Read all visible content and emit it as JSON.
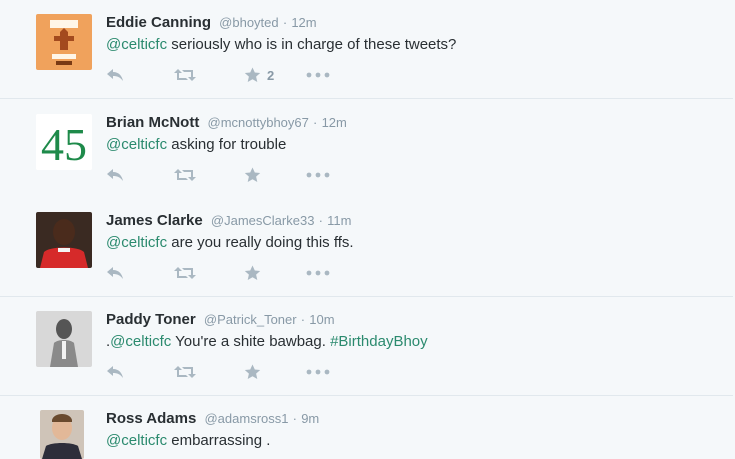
{
  "tweets": [
    {
      "name": "Eddie Canning",
      "handle": "@bhoyted",
      "separator": "·",
      "time": "12m",
      "mention": "@celticfc",
      "prefix": "",
      "text": " seriously who is in charge of these tweets?",
      "hashtag": "",
      "favorite_count": "2",
      "avatar": "csc-crest-avatar"
    },
    {
      "name": "Brian McNott",
      "handle": "@mcnottybhoy67",
      "separator": "·",
      "time": "12m",
      "mention": "@celticfc",
      "prefix": "",
      "text": " asking for trouble",
      "hashtag": "",
      "favorite_count": "",
      "avatar": "number-45-avatar",
      "avatar_text": "45"
    },
    {
      "name": "James Clarke",
      "handle": "@JamesClarke33",
      "separator": "·",
      "time": "11m",
      "mention": "@celticfc",
      "prefix": "",
      "text": " are you really doing this ffs.",
      "hashtag": "",
      "favorite_count": "",
      "avatar": "footballer-photo-avatar"
    },
    {
      "name": "Paddy Toner",
      "handle": "@Patrick_Toner",
      "separator": "·",
      "time": "10m",
      "mention": "@celticfc",
      "prefix": ".",
      "text": " You're a shite bawbag. ",
      "hashtag": "#BirthdayBhoy",
      "favorite_count": "",
      "avatar": "bw-portrait-avatar"
    },
    {
      "name": "Ross Adams",
      "handle": "@adamsross1",
      "separator": "·",
      "time": "9m",
      "mention": "@celticfc",
      "prefix": "",
      "text": " embarrassing .",
      "hashtag": "",
      "favorite_count": "",
      "avatar": "selfie-avatar"
    }
  ],
  "colors": {
    "link": "#2b8a6e",
    "text": "#292f33",
    "muted": "#8899a6",
    "icon": "#aab8c2",
    "background": "#f5f8fa"
  },
  "icons": [
    "reply-icon",
    "retweet-icon",
    "favorite-icon",
    "more-icon"
  ]
}
